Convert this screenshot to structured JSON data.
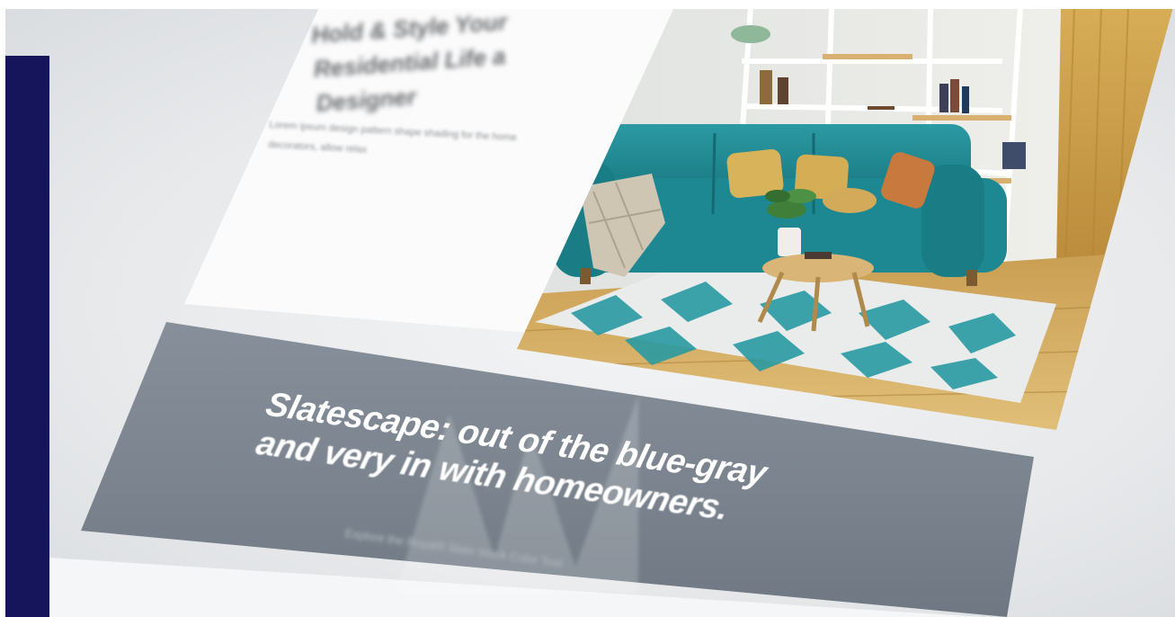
{
  "hero_card": {
    "title": "Hold & Style Your Residential Life a Designer",
    "body": "Lorem ipsum design pattern shape shading for the home decorators, allow relax"
  },
  "banner": {
    "headline_line1": "Slatescape: out of the blue-gray",
    "headline_line2": "and very in with homeowners.",
    "subtext": "Explore the Royal® Slate Stack Color Tool"
  },
  "colors": {
    "accent_bar": "#16145a",
    "banner_gray": "#7a838d",
    "sofa_teal": "#1f8a93",
    "pillow_gold": "#d9b35a"
  },
  "photo": {
    "subject": "living-room-teal-sofa-photo"
  }
}
